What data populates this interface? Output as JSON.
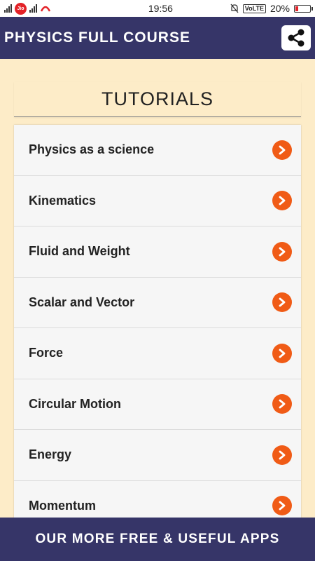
{
  "status_bar": {
    "time": "19:56",
    "carrier": "Jio",
    "network_badge": "VoLTE",
    "battery_percent": "20%",
    "battery_level": 0.2
  },
  "app_bar": {
    "title": "PHYSICS FULL COURSE",
    "share_icon": "share-icon"
  },
  "card": {
    "title": "TUTORIALS",
    "items": [
      {
        "label": "Physics as a science"
      },
      {
        "label": "Kinematics"
      },
      {
        "label": "Fluid and Weight"
      },
      {
        "label": "Scalar and Vector"
      },
      {
        "label": "Force"
      },
      {
        "label": "Circular Motion"
      },
      {
        "label": "Energy"
      },
      {
        "label": "Momentum"
      }
    ]
  },
  "bottom_banner": {
    "label": "OUR MORE FREE & USEFUL APPS"
  },
  "colors": {
    "primary": "#363568",
    "accent": "#f05b16",
    "background": "#fdecc8",
    "list_background": "#f6f6f6"
  }
}
